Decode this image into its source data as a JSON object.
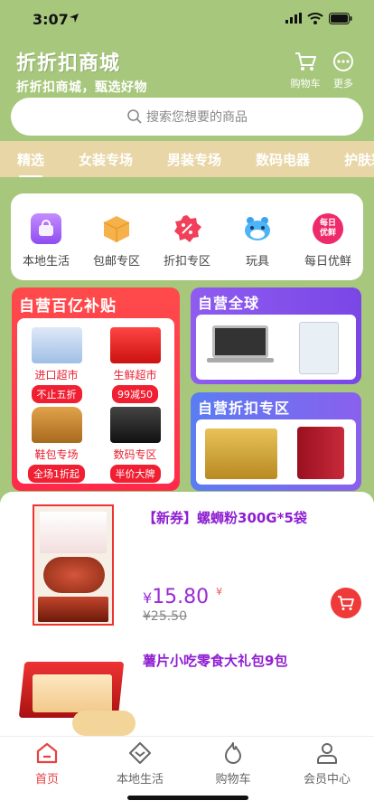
{
  "status_bar": {
    "time": "3:07"
  },
  "header": {
    "title": "折折扣商城",
    "subtitle": "折折扣商城，甄选好物",
    "cart_label": "购物车",
    "more_label": "更多"
  },
  "search": {
    "placeholder": "搜索您想要的商品"
  },
  "category_tabs": [
    {
      "label": "精选",
      "active": true
    },
    {
      "label": "女装专场"
    },
    {
      "label": "男装专场"
    },
    {
      "label": "数码电器"
    },
    {
      "label": "护肤彩"
    }
  ],
  "quick_entries": [
    {
      "label": "本地生活",
      "icon": "shopping-bag-icon"
    },
    {
      "label": "包邮专区",
      "icon": "box-icon"
    },
    {
      "label": "折扣专区",
      "icon": "discount-icon"
    },
    {
      "label": "玩具",
      "icon": "toy-icon"
    },
    {
      "label": "每日优鲜",
      "icon": "fresh-icon",
      "icon_text": "每日优鲜"
    }
  ],
  "promo_left": {
    "title": "自营百亿补贴",
    "cells": [
      {
        "name": "进口超市",
        "badge": "不止五折"
      },
      {
        "name": "生鲜超市",
        "badge": "99减50"
      },
      {
        "name": "鞋包专场",
        "badge": "全场1折起"
      },
      {
        "name": "数码专区",
        "badge": "半价大牌"
      }
    ]
  },
  "promo_right_top": {
    "title": "自营全球"
  },
  "promo_right_bottom": {
    "title": "自营折扣专区"
  },
  "products": [
    {
      "title": "【新券】螺蛳粉300G*5袋",
      "currency": "¥",
      "price": "15.80",
      "price_suffix": "¥",
      "old_price": "¥25.50"
    },
    {
      "title": "薯片小吃零食大礼包9包"
    }
  ],
  "tabbar": [
    {
      "label": "首页",
      "icon": "home-icon",
      "active": true
    },
    {
      "label": "本地生活",
      "icon": "local-life-icon"
    },
    {
      "label": "购物车",
      "icon": "cart-flame-icon"
    },
    {
      "label": "会员中心",
      "icon": "user-icon"
    }
  ],
  "colors": {
    "background": "#a7c77c",
    "accent": "#e54242",
    "price": "#9a2bd6"
  }
}
